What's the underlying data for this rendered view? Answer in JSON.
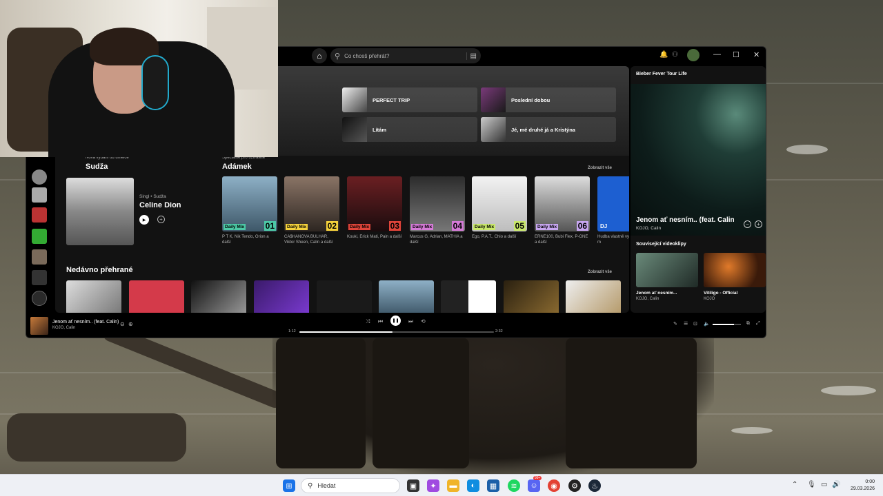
{
  "spotify": {
    "search_placeholder": "Co chceš přehrát?",
    "quick_picks": [
      {
        "title": "PERFECT TRIP"
      },
      {
        "title": "Poslední dobou"
      },
      {
        "title": "Lítám"
      },
      {
        "title": "Jé, mé druhé já a Kristýna"
      }
    ],
    "new_releases": {
      "small": "Nová vydání od umělce",
      "title": "Sudža",
      "meta": "Singl • Sudža",
      "release_title": "Celine Dion"
    },
    "made_for": {
      "small": "Speciálně pro uživatele",
      "title": "Adámek",
      "show_all": "Zobrazit vše",
      "mixes": [
        {
          "label": "Daily Mix",
          "num": "01",
          "desc": "P T K, Nik Tendo, Orion a další",
          "color": "#4cc9a6"
        },
        {
          "label": "Daily Mix",
          "num": "02",
          "desc": "CA$HANOVA BULHAR, Viktor Sheen, Calin a další",
          "color": "#f5d23c"
        },
        {
          "label": "Daily Mix",
          "num": "03",
          "desc": "Kouki, Erick Mati, Pain a další",
          "color": "#e0453a"
        },
        {
          "label": "Daily Mix",
          "num": "04",
          "desc": "Marcus G, Adrian, MATHIA a další",
          "color": "#d57ad7"
        },
        {
          "label": "Daily Mix",
          "num": "05",
          "desc": "Ego, P.A.T., Chio a další",
          "color": "#c9e86b"
        },
        {
          "label": "Daily Mix",
          "num": "06",
          "desc": "ERNE100, Bubi Flex, P-ONE a další",
          "color": "#c7a6f0"
        },
        {
          "label": "DJ",
          "num": "",
          "desc": "Hudba vlastně vybraná tvým m",
          "color": "#1ed760"
        }
      ]
    },
    "recent": {
      "title": "Nedávno přehrané",
      "show_all": "Zobrazit vše"
    },
    "right_panel": {
      "title": "Bieber Fever Tour Life",
      "song": "Jenom ať nesním.. (feat. Calin",
      "artist": "KOJO, Calin",
      "related_title": "Související videoklipy",
      "clips": [
        {
          "title": "Jenom ať nesním...",
          "artist": "KOJO, Calin"
        },
        {
          "title": "Vitiligo - Official",
          "artist": "KOJO"
        }
      ]
    },
    "player": {
      "title": "Jenom ať nesním.. (feat. Calin)",
      "artist": "KOJO, Calin",
      "elapsed": "1:12",
      "total": "2:32",
      "progress": 0.48,
      "volume": 0.75
    }
  },
  "taskbar": {
    "search_placeholder": "Hledat",
    "badge": "99+",
    "time": "0:00",
    "date": "29.03.2026"
  },
  "colors": {
    "accent": "#1ed760",
    "bg": "#121212"
  }
}
